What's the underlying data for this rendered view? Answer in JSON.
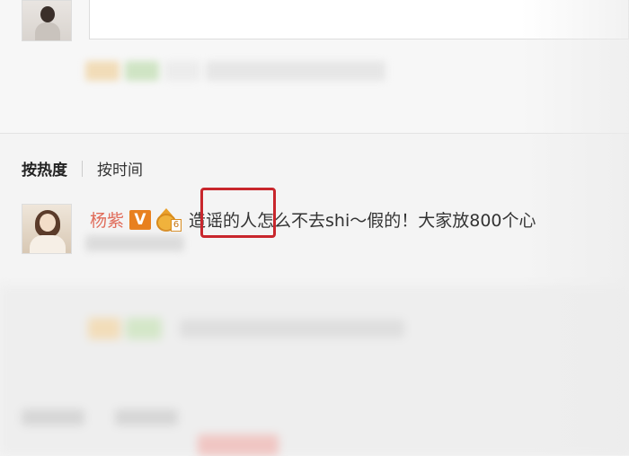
{
  "sort_tabs": {
    "hot": "按热度",
    "time": "按时间"
  },
  "comment": {
    "user_name": "杨紫",
    "verified_badge": "V",
    "vip_level": "6",
    "text_highlighted": "造谣的",
    "text_rest": "人怎么不去shi～假的！大家放800个心"
  },
  "colors": {
    "user_name": "#e06c5a",
    "verified_badge": "#e8801f",
    "highlight_box": "#c8262c"
  },
  "icons": {
    "verified": "verified-v-icon",
    "vip": "vip-crown-icon"
  }
}
